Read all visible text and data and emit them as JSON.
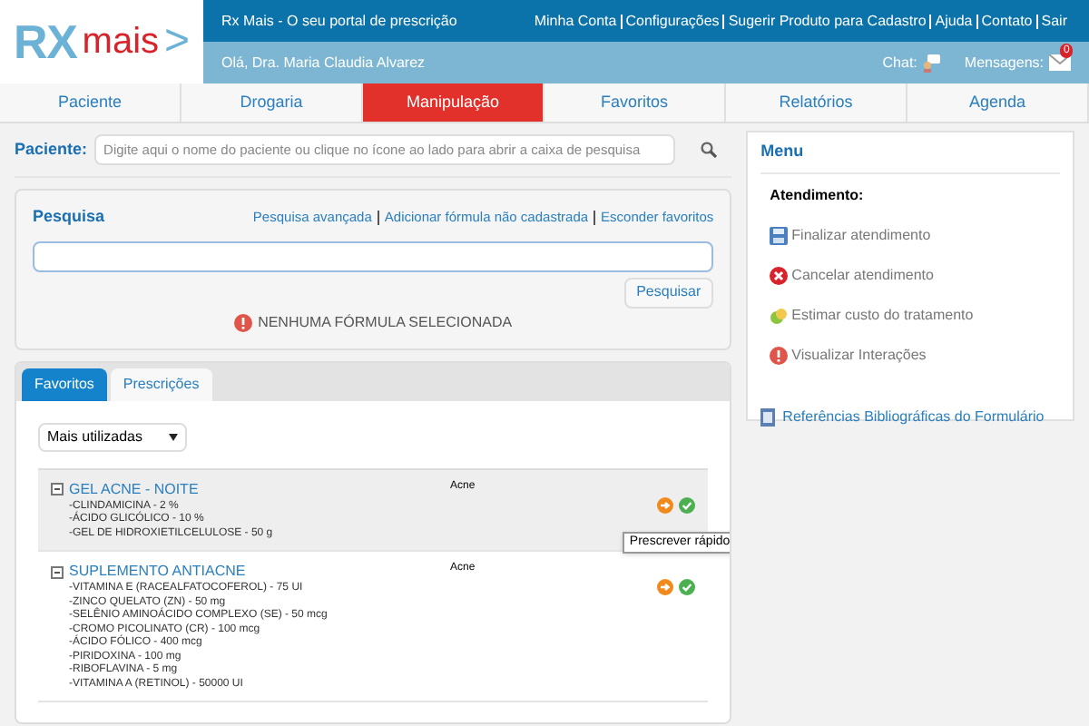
{
  "logo": {
    "part_1": "RX",
    "part_2": "mais",
    "part_3": ">"
  },
  "header": {
    "tagline": "Rx Mais - O seu portal de prescrição",
    "links": [
      "Minha Conta",
      "Configurações",
      "Sugerir Produto para Cadastro",
      "Ajuda",
      "Contato",
      "Sair"
    ],
    "greeting": "Olá, Dra. Maria Claudia Alvarez",
    "chat_label": "Chat:",
    "messages_label": "Mensagens:",
    "messages_count": "0"
  },
  "nav": [
    {
      "label": "Paciente",
      "selected": false
    },
    {
      "label": "Drogaria",
      "selected": false
    },
    {
      "label": "Manipulação",
      "selected": true
    },
    {
      "label": "Favoritos",
      "selected": false
    },
    {
      "label": "Relatórios",
      "selected": false
    },
    {
      "label": "Agenda",
      "selected": false
    }
  ],
  "patient": {
    "label": "Paciente:",
    "placeholder": "Digite aqui o nome do paciente ou clique no ícone ao lado para abrir a caixa de pesquisa"
  },
  "search": {
    "title": "Pesquisa",
    "links": [
      "Pesquisa avançada",
      "Adicionar fórmula não cadastrada",
      "Esconder favoritos"
    ],
    "button": "Pesquisar",
    "notice": "NENHUMA FÓRMULA SELECIONADA"
  },
  "tabs": [
    {
      "label": "Favoritos",
      "selected": true
    },
    {
      "label": "Prescrições",
      "selected": false
    }
  ],
  "filter": {
    "value": "Mais utilizadas"
  },
  "formulas": [
    {
      "name": "GEL ACNE - NOITE",
      "category": "Acne",
      "hovered": true,
      "ingredients": [
        "-CLINDAMICINA - 2 %",
        "-ÁCIDO GLICÓLICO - 10 %",
        "-GEL DE HIDROXIETILCELULOSE - 50 g"
      ]
    },
    {
      "name": "SUPLEMENTO ANTIACNE",
      "category": "Acne",
      "hovered": false,
      "ingredients": [
        "-VITAMINA E (RACEALFATOCOFEROL) - 75 UI",
        "-ZINCO QUELATO (ZN) - 50 mg",
        "-SELÊNIO AMINOÁCIDO COMPLEXO (SE) - 50 mcg",
        "-CROMO PICOLINATO (CR) - 100 mcg",
        "-ÁCIDO FÓLICO - 400 mcg",
        "-PIRIDOXINA - 100 mg",
        "-RIBOFLAVINA - 5 mg",
        "-VITAMINA A (RETINOL) - 50000 UI"
      ]
    }
  ],
  "tooltip": "Prescrever rápido",
  "menu": {
    "title": "Menu",
    "section": "Atendimento:",
    "items": [
      {
        "kind": "save",
        "label": "Finalizar atendimento"
      },
      {
        "kind": "cancel",
        "label": "Cancelar atendimento"
      },
      {
        "kind": "cost",
        "label": "Estimar custo do tratamento"
      },
      {
        "kind": "alert",
        "label": "Visualizar Interações"
      }
    ],
    "reference": "Referências Bibliográficas do Formulário"
  }
}
